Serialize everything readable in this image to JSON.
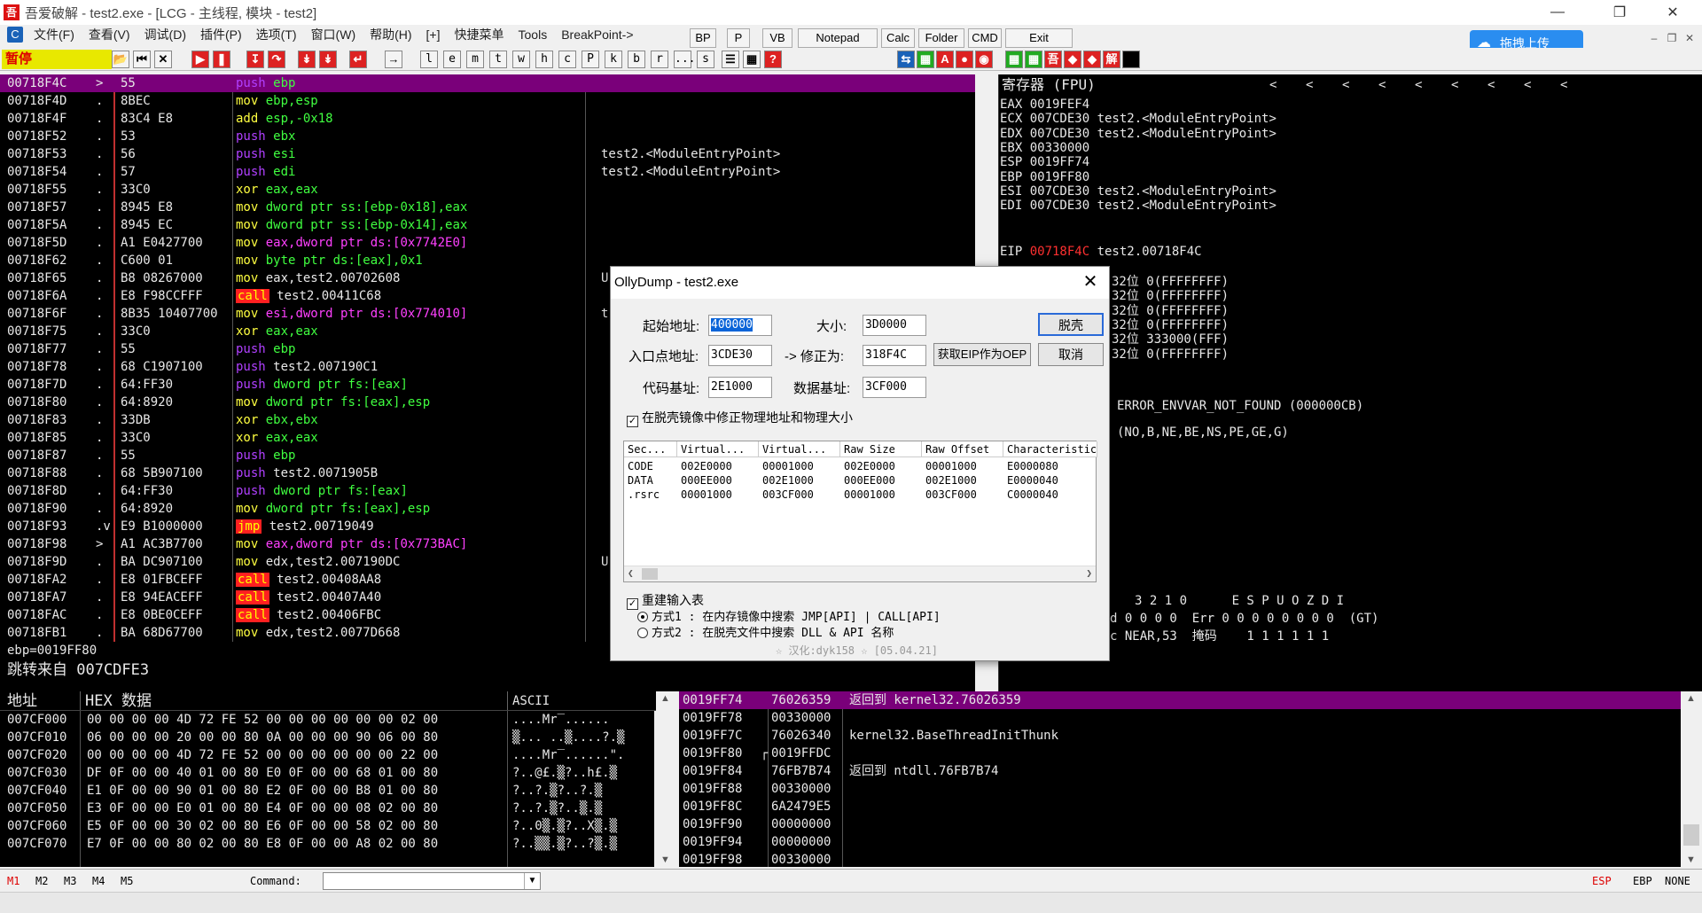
{
  "window": {
    "title": "吾爱破解 - test2.exe - [LCG - 主线程, 模块 - test2]"
  },
  "menu": [
    "文件(F)",
    "查看(V)",
    "调试(D)",
    "插件(P)",
    "选项(T)",
    "窗口(W)",
    "帮助(H)",
    "[+]",
    "快捷菜单",
    "Tools",
    "BreakPoint->"
  ],
  "quick_buttons": [
    "BP",
    "P",
    "VB",
    "Notepad",
    "Calc",
    "Folder",
    "CMD",
    "Exit"
  ],
  "toolbar": {
    "status": "暂停",
    "letters": [
      "l",
      "e",
      "m",
      "t",
      "w",
      "h",
      "c",
      "P",
      "k",
      "b",
      "r",
      "...",
      "s"
    ]
  },
  "upload_button": "拖拽上传",
  "disasm": [
    {
      "addr": "00718F4C",
      "mark": ">",
      "hex": "55",
      "mn": "push",
      "op": "ebp",
      "sel": true
    },
    {
      "addr": "00718F4D",
      "mark": ".",
      "hex": "8BEC",
      "mn": "mov",
      "op": "ebp,esp"
    },
    {
      "addr": "00718F4F",
      "mark": ".",
      "hex": "83C4 E8",
      "mn": "add",
      "op": "esp,-0x18"
    },
    {
      "addr": "00718F52",
      "mark": ".",
      "hex": "53",
      "mn": "push",
      "op": "ebx"
    },
    {
      "addr": "00718F53",
      "mark": ".",
      "hex": "56",
      "mn": "push",
      "op": "esi",
      "cmt": "test2.<ModuleEntryPoint>"
    },
    {
      "addr": "00718F54",
      "mark": ".",
      "hex": "57",
      "mn": "push",
      "op": "edi",
      "cmt": "test2.<ModuleEntryPoint>"
    },
    {
      "addr": "00718F55",
      "mark": ".",
      "hex": "33C0",
      "mn": "xor",
      "op": "eax,eax"
    },
    {
      "addr": "00718F57",
      "mark": ".",
      "hex": "8945 E8",
      "mn": "mov",
      "op": "dword ptr ss:[ebp-0x18],eax"
    },
    {
      "addr": "00718F5A",
      "mark": ".",
      "hex": "8945 EC",
      "mn": "mov",
      "op": "dword ptr ss:[ebp-0x14],eax"
    },
    {
      "addr": "00718F5D",
      "mark": ".",
      "hex": "A1 E0427700",
      "mn": "mov",
      "op": "eax,dword ptr ds:[0x7742E0]"
    },
    {
      "addr": "00718F62",
      "mark": ".",
      "hex": "C600 01",
      "mn": "mov",
      "op": "byte ptr ds:[eax],0x1"
    },
    {
      "addr": "00718F65",
      "mark": ".",
      "hex": "B8 08267000",
      "mn": "mov",
      "op": "eax,test2.00702608",
      "cmt": "U"
    },
    {
      "addr": "00718F6A",
      "mark": ".",
      "hex": "E8 F98CCFFF",
      "mn": "call",
      "op": "test2.00411C68"
    },
    {
      "addr": "00718F6F",
      "mark": ".",
      "hex": "8B35 10407700",
      "mn": "mov",
      "op": "esi,dword ptr ds:[0x774010]",
      "cmt": "t"
    },
    {
      "addr": "00718F75",
      "mark": ".",
      "hex": "33C0",
      "mn": "xor",
      "op": "eax,eax"
    },
    {
      "addr": "00718F77",
      "mark": ".",
      "hex": "55",
      "mn": "push",
      "op": "ebp"
    },
    {
      "addr": "00718F78",
      "mark": ".",
      "hex": "68 C1907100",
      "mn": "push",
      "op": "test2.007190C1"
    },
    {
      "addr": "00718F7D",
      "mark": ".",
      "hex": "64:FF30",
      "mn": "push",
      "op": "dword ptr fs:[eax]"
    },
    {
      "addr": "00718F80",
      "mark": ".",
      "hex": "64:8920",
      "mn": "mov",
      "op": "dword ptr fs:[eax],esp"
    },
    {
      "addr": "00718F83",
      "mark": ".",
      "hex": "33DB",
      "mn": "xor",
      "op": "ebx,ebx"
    },
    {
      "addr": "00718F85",
      "mark": ".",
      "hex": "33C0",
      "mn": "xor",
      "op": "eax,eax"
    },
    {
      "addr": "00718F87",
      "mark": ".",
      "hex": "55",
      "mn": "push",
      "op": "ebp"
    },
    {
      "addr": "00718F88",
      "mark": ".",
      "hex": "68 5B907100",
      "mn": "push",
      "op": "test2.0071905B"
    },
    {
      "addr": "00718F8D",
      "mark": ".",
      "hex": "64:FF30",
      "mn": "push",
      "op": "dword ptr fs:[eax]"
    },
    {
      "addr": "00718F90",
      "mark": ".",
      "hex": "64:8920",
      "mn": "mov",
      "op": "dword ptr fs:[eax],esp"
    },
    {
      "addr": "00718F93",
      "mark": ".v",
      "hex": "E9 B1000000",
      "mn": "jmp",
      "op": "test2.00719049"
    },
    {
      "addr": "00718F98",
      "mark": ">",
      "hex": "A1 AC3B7700",
      "mn": "mov",
      "op": "eax,dword ptr ds:[0x773BAC]"
    },
    {
      "addr": "00718F9D",
      "mark": ".",
      "hex": "BA DC907100",
      "mn": "mov",
      "op": "edx,test2.007190DC",
      "cmt": "U"
    },
    {
      "addr": "00718FA2",
      "mark": ".",
      "hex": "E8 01FBCEFF",
      "mn": "call",
      "op": "test2.00408AA8"
    },
    {
      "addr": "00718FA7",
      "mark": ".",
      "hex": "E8 94EACEFF",
      "mn": "call",
      "op": "test2.00407A40"
    },
    {
      "addr": "00718FAC",
      "mark": ".",
      "hex": "E8 0BE0CEFF",
      "mn": "call",
      "op": "test2.00406FBC"
    },
    {
      "addr": "00718FB1",
      "mark": ".",
      "hex": "BA 68D67700",
      "mn": "mov",
      "op": "edx,test2.0077D668"
    }
  ],
  "info": [
    "ebp=0019FF80",
    "跳转来自 007CDFE3"
  ],
  "registers": {
    "header": "寄存器 (FPU)",
    "arrows": [
      "<",
      "<",
      "<",
      "<",
      "<",
      "<",
      "<",
      "<",
      "<"
    ],
    "rows": [
      {
        "name": "EAX",
        "val": "0019FEF4",
        "cmt": ""
      },
      {
        "name": "ECX",
        "val": "007CDE30",
        "cmt": "test2.<ModuleEntryPoint>"
      },
      {
        "name": "EDX",
        "val": "007CDE30",
        "cmt": "test2.<ModuleEntryPoint>"
      },
      {
        "name": "EBX",
        "val": "00330000",
        "cmt": ""
      },
      {
        "name": "ESP",
        "val": "0019FF74",
        "cmt": ""
      },
      {
        "name": "EBP",
        "val": "0019FF80",
        "cmt": ""
      },
      {
        "name": "ESI",
        "val": "007CDE30",
        "cmt": "test2.<ModuleEntryPoint>"
      },
      {
        "name": "EDI",
        "val": "007CDE30",
        "cmt": "test2.<ModuleEntryPoint>"
      }
    ],
    "eip": {
      "name": "EIP",
      "val": "00718F4C",
      "cmt": "test2.00718F4C"
    },
    "seg": [
      "32位 0(FFFFFFFF)",
      "32位 0(FFFFFFFF)",
      "32位 0(FFFFFFFF)",
      "32位 0(FFFFFFFF)",
      "32位 333000(FFF)",
      "32位 0(FFFFFFFF)"
    ],
    "lasterr": "ERROR_ENVVAR_NOT_FOUND (000000CB)",
    "flags": "(NO,B,NE,BE,NS,PE,GE,G)",
    "fpu1": "3 2 1 0      E S P U O Z D I",
    "fpu2": "d 0 0 0 0  Err 0 0 0 0 0 0 0 0  (GT)",
    "fpu3": "c NEAR,53  掩码    1 1 1 1 1 1"
  },
  "dump": {
    "headers": [
      "地址",
      "HEX 数据",
      "ASCII"
    ],
    "rows": [
      {
        "addr": "007CF000",
        "hex": "00 00 00 00 4D 72 FE 52 00 00 00 00 00 00 02 00",
        "ascii": "....Mr‾......"
      },
      {
        "addr": "007CF010",
        "hex": "06 00 00 00 20 00 00 80 0A 00 00 00 90 06 00 80",
        "ascii": "▒... ..▒....?.▒"
      },
      {
        "addr": "007CF020",
        "hex": "00 00 00 00 4D 72 FE 52 00 00 00 00 00 00 22 00",
        "ascii": "....Mr‾......\"."
      },
      {
        "addr": "007CF030",
        "hex": "DF 0F 00 00 40 01 00 80 E0 0F 00 00 68 01 00 80",
        "ascii": "?..@£.▒?..h£.▒"
      },
      {
        "addr": "007CF040",
        "hex": "E1 0F 00 00 90 01 00 80 E2 0F 00 00 B8 01 00 80",
        "ascii": "?..?.▒?..?.▒"
      },
      {
        "addr": "007CF050",
        "hex": "E3 0F 00 00 E0 01 00 80 E4 0F 00 00 08 02 00 80",
        "ascii": "?..?.▒?..▒.▒"
      },
      {
        "addr": "007CF060",
        "hex": "E5 0F 00 00 30 02 00 80 E6 0F 00 00 58 02 00 80",
        "ascii": "?..0▒.▒?..X▒.▒"
      },
      {
        "addr": "007CF070",
        "hex": "E7 0F 00 00 80 02 00 80 E8 0F 00 00 A8 02 00 80",
        "ascii": "?..▒▒.▒?..?▒.▒"
      }
    ]
  },
  "stack": [
    {
      "addr": "0019FF74",
      "mark": "",
      "val": "76026359",
      "cmt": "返回到 kernel32.76026359",
      "sel": true
    },
    {
      "addr": "0019FF78",
      "mark": "",
      "val": "00330000",
      "cmt": ""
    },
    {
      "addr": "0019FF7C",
      "mark": "",
      "val": "76026340",
      "cmt": "kernel32.BaseThreadInitThunk"
    },
    {
      "addr": "0019FF80",
      "mark": "r",
      "val": "0019FFDC",
      "cmt": ""
    },
    {
      "addr": "0019FF84",
      "mark": "",
      "val": "76FB7B74",
      "cmt": "返回到 ntdll.76FB7B74"
    },
    {
      "addr": "0019FF88",
      "mark": "",
      "val": "00330000",
      "cmt": ""
    },
    {
      "addr": "0019FF8C",
      "mark": "",
      "val": "6A2479E5",
      "cmt": ""
    },
    {
      "addr": "0019FF90",
      "mark": "",
      "val": "00000000",
      "cmt": ""
    },
    {
      "addr": "0019FF94",
      "mark": "",
      "val": "00000000",
      "cmt": ""
    },
    {
      "addr": "0019FF98",
      "mark": "",
      "val": "00330000",
      "cmt": ""
    }
  ],
  "status": {
    "marks": [
      "M1",
      "M2",
      "M3",
      "M4",
      "M5"
    ],
    "command_label": "Command:",
    "right": [
      "ESP",
      "EBP",
      "NONE"
    ]
  },
  "dialog": {
    "title": "OllyDump - test2.exe",
    "start_label": "起始地址:",
    "start": "400000",
    "size_label": "大小:",
    "size": "3D0000",
    "entry_label": "入口点地址:",
    "entry": "3CDE30",
    "fixed_label": "-> 修正为:",
    "fixed": "318F4C",
    "code_label": "代码基址:",
    "code": "2E1000",
    "data_label": "数据基址:",
    "data": "3CF000",
    "dump_btn": "脱壳",
    "eip_btn": "获取EIP作为OEP",
    "cancel_btn": "取消",
    "fix_check": "在脱壳镜像中修正物理地址和物理大小",
    "columns": [
      "Sec...",
      "Virtual...",
      "Virtual...",
      "Raw Size",
      "Raw Offset",
      "Characteristic"
    ],
    "sections": [
      [
        "CODE",
        "002E0000",
        "00001000",
        "002E0000",
        "00001000",
        "E0000080"
      ],
      [
        "DATA",
        "000EE000",
        "002E1000",
        "000EE000",
        "002E1000",
        "E0000040"
      ],
      [
        ".rsrc",
        "00001000",
        "003CF000",
        "00001000",
        "003CF000",
        "C0000040"
      ]
    ],
    "rebuild_check": "重建输入表",
    "method1": "方式1 : 在内存镜像中搜索 JMP[API] | CALL[API]",
    "method2": "方式2 : 在脱壳文件中搜索 DLL & API 名称",
    "credit": "☆ 汉化:dyk158 ☆ [05.04.21]"
  }
}
